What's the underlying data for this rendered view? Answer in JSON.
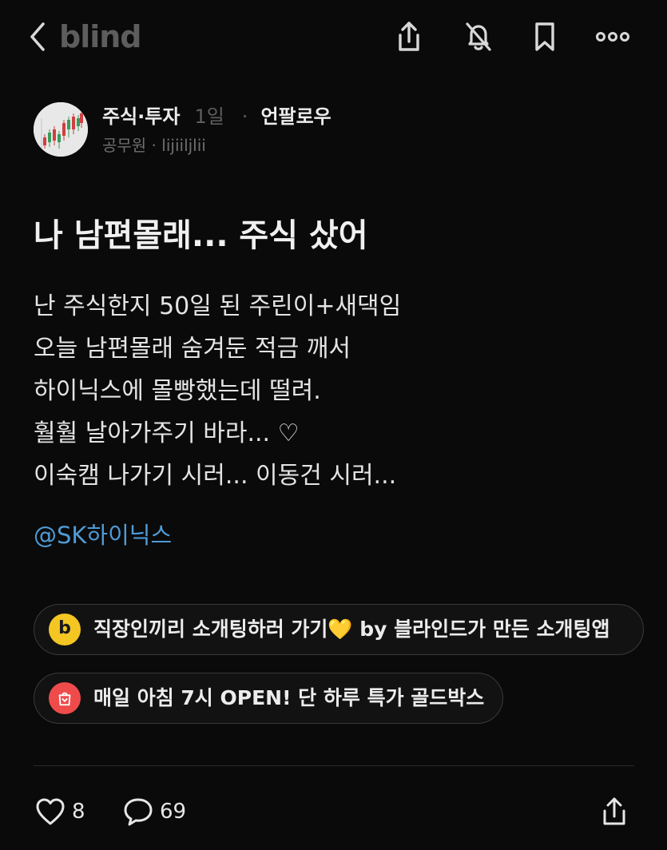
{
  "header": {
    "logo_text": "blind",
    "icons": [
      "chevron-left-icon",
      "share-icon",
      "bell-off-icon",
      "bookmark-icon",
      "more-icon"
    ]
  },
  "author": {
    "board": "주식·투자",
    "time": "1일",
    "separator": "·",
    "follow_label": "언팔로우",
    "company": "공무원",
    "nickname_sep": " · ",
    "nickname": "lijiiljlii"
  },
  "post": {
    "title": "나 남편몰래... 주식 샀어",
    "body_lines": [
      "난 주식한지 50일 된 주린이+새댁임",
      "오늘 남편몰래 숨겨둔 적금 깨서",
      "하이닉스에 몰빵했는데 떨려.",
      "훨훨 날아가주기 바라... ♡",
      "이숙캠 나가기 시러... 이동건 시러..."
    ],
    "mention": "@SK하이닉스"
  },
  "promos": [
    {
      "icon": "b",
      "text": "직장인끼리 소개팅하러 가기💛 by 블라인드가 만든 소개팅앱"
    },
    {
      "icon": "shopping-bag-icon",
      "text": "매일 아침 7시 OPEN! 단 하루 특가 골드박스"
    }
  ],
  "actions": {
    "likes": "8",
    "comments": "69"
  },
  "colors": {
    "background": "#0a0a0a",
    "mention": "#4f9bd6",
    "chip_yellow": "#f3c623",
    "chip_red": "#ef4b4b"
  }
}
